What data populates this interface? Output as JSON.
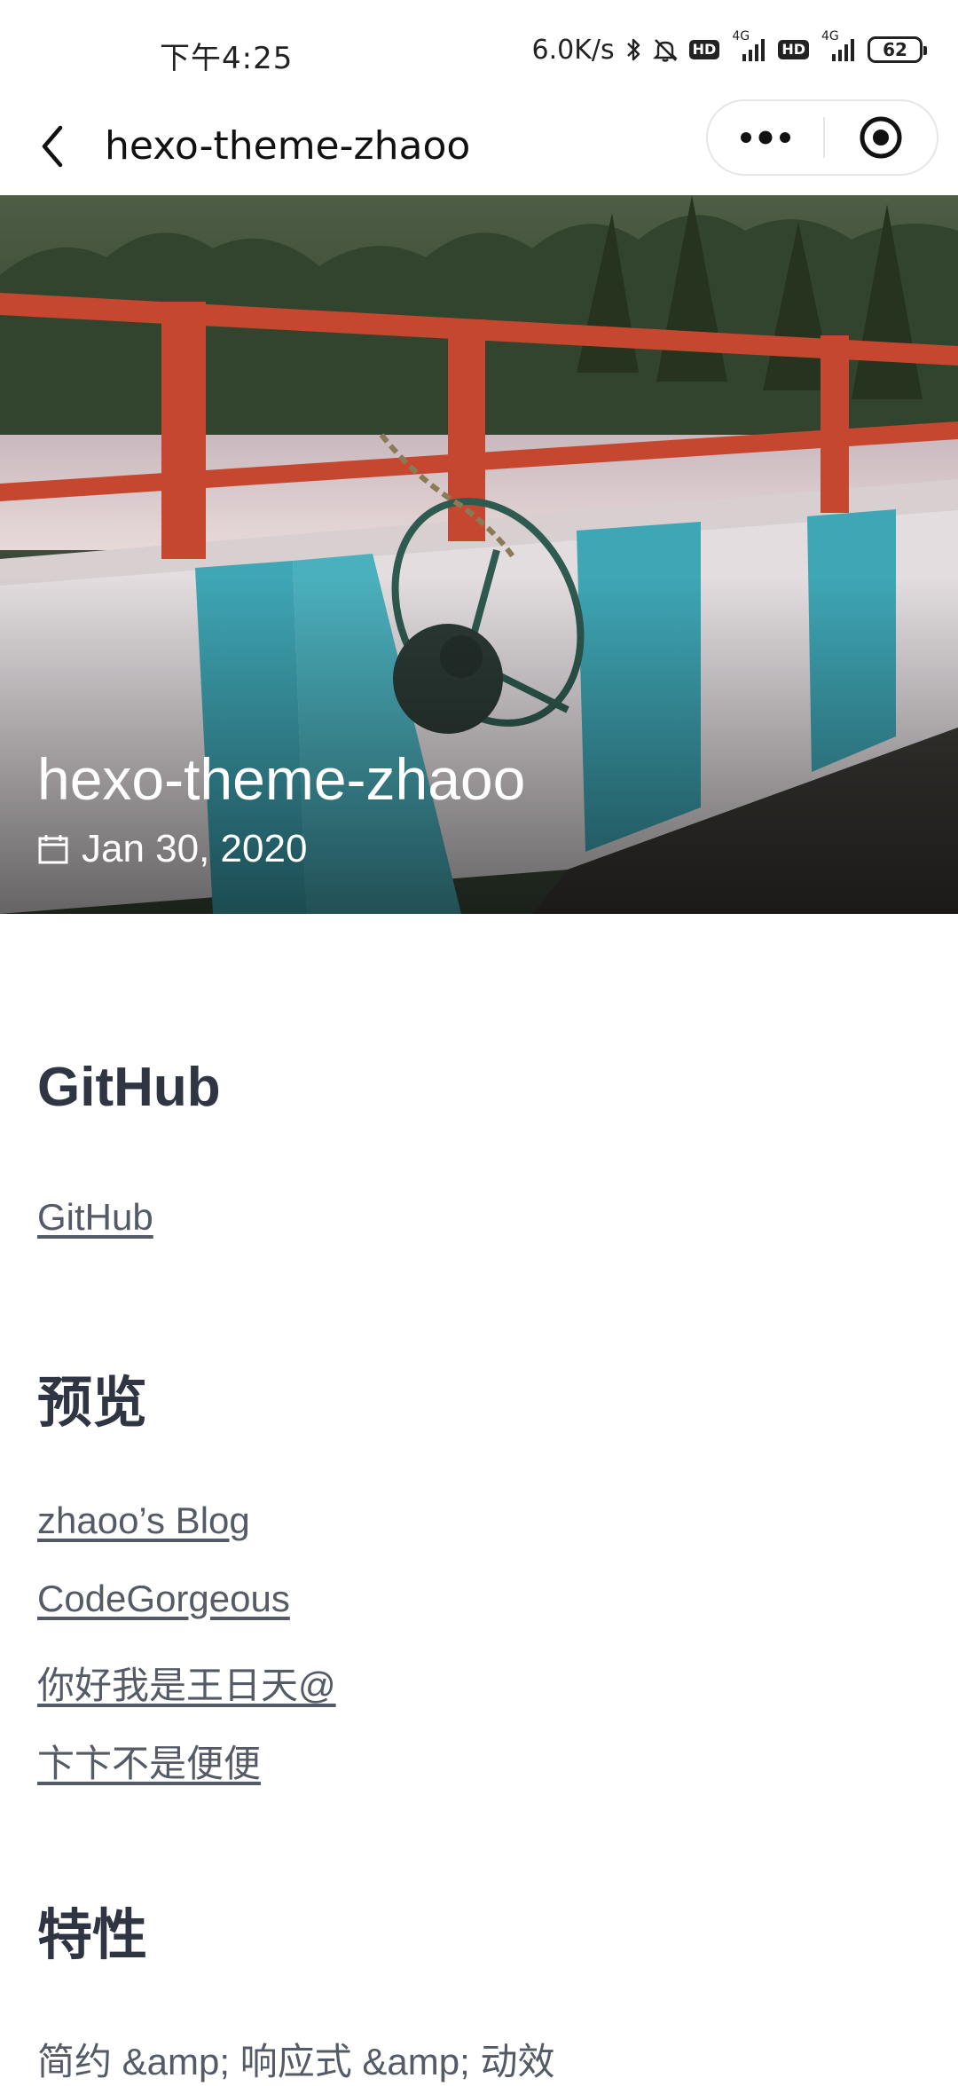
{
  "status_bar": {
    "time": "下午4:25",
    "network_speed": "6.0K/s",
    "hd1": "HD",
    "hd2": "HD",
    "net1": "4G",
    "net2": "4G",
    "battery": "62"
  },
  "nav": {
    "title": "hexo-theme-zhaoo"
  },
  "hero": {
    "title": "hexo-theme-zhaoo",
    "date": "Jan 30, 2020"
  },
  "content": {
    "github_heading": "GitHub",
    "github_link": "GitHub",
    "preview_heading": "预览",
    "preview_links": [
      "zhaoo’s Blog",
      "CodeGorgeous",
      "你好我是王日天@",
      "卞卞不是便便"
    ],
    "features_heading": "特性",
    "features_first": "简约 &amp; 响应式 &amp; 动效"
  },
  "colors": {
    "heading": "#2f3542",
    "body_text": "#555b66",
    "railing": "#c5472f",
    "wall_teal": "#3fa6b5"
  }
}
